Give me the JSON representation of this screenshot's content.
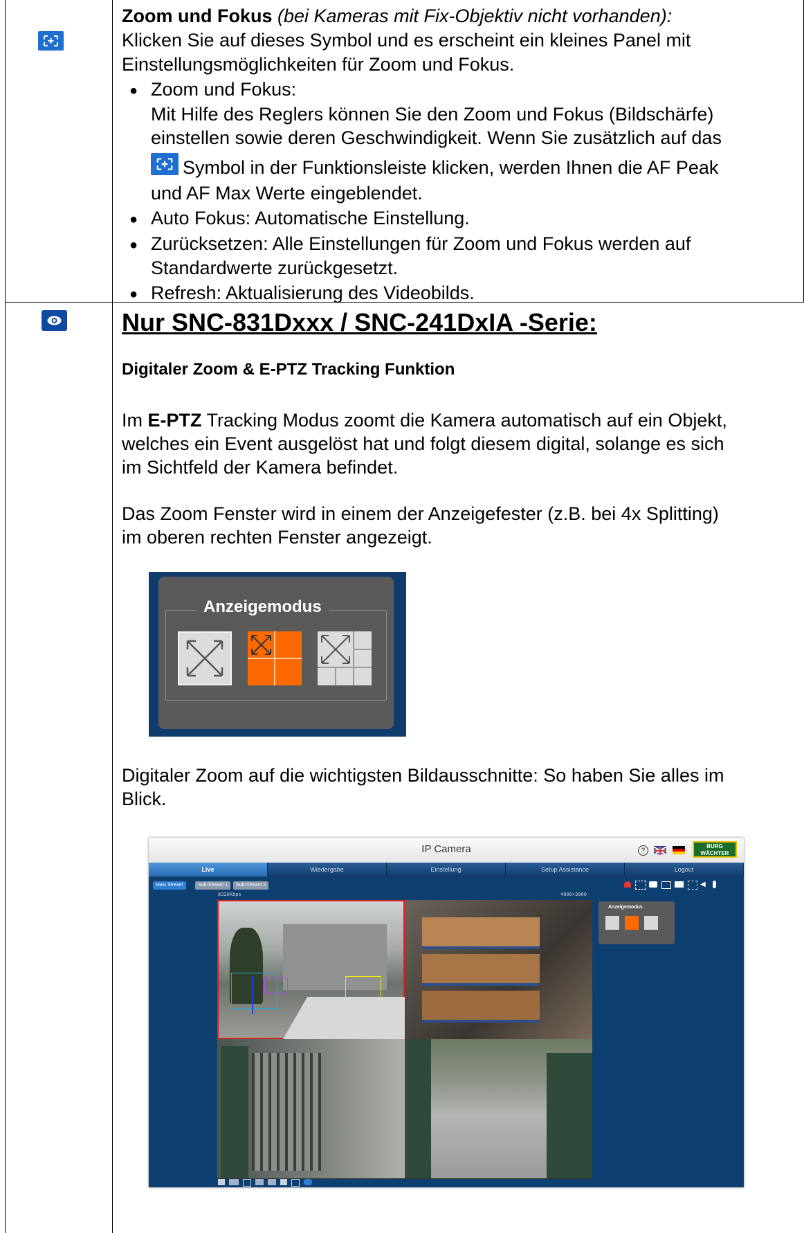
{
  "row1": {
    "icon": "zoom-focus-icon",
    "heading": "Zoom und Fokus",
    "heading_note": "(bei Kameras mit Fix-Objektiv nicht vorhanden):",
    "intro_line1": "Klicken Sie auf dieses Symbol und es erscheint ein kleines Panel mit",
    "intro_line2": "Einstellungsmöglichkeiten für Zoom und Fokus.",
    "bullets": [
      {
        "label": "Zoom und Fokus:",
        "lines": [
          "Mit Hilfe des Reglers können Sie den Zoom und Fokus (Bildschärfe)",
          "einstellen sowie deren Geschwindigkeit. Wenn Sie zusätzlich auf das",
          "Symbol in der Funktionsleiste klicken, werden Ihnen die AF Peak",
          "und AF Max Werte eingeblendet."
        ]
      },
      {
        "label": "Auto Fokus: Automatische Einstellung."
      },
      {
        "label": "Zurücksetzen: Alle Einstellungen für Zoom und Fokus werden auf",
        "line2": "Standardwerte zurückgesetzt."
      },
      {
        "label": "Refresh: Aktualisierung des Videobilds."
      }
    ]
  },
  "row2": {
    "icon": "eye-icon",
    "title": "Nur SNC-831Dxxx / SNC-241DxIA -Serie:",
    "subtitle": "Digitaler Zoom & E-PTZ Tracking Funktion",
    "para1_bold": "E-PTZ",
    "para1_pre": "Im ",
    "para1_line1": " Tracking Modus zoomt die Kamera automatisch auf ein Objekt,",
    "para1_line2": "welches ein Event ausgelöst hat und folgt diesem digital, solange es sich",
    "para1_line3": "im Sichtfeld der Kamera befindet.",
    "para2_line1": "Das Zoom Fenster wird in einem der Anzeigefester (z.B. bei 4x Splitting)",
    "para2_line2": "im oberen rechten Fenster angezeigt.",
    "panel_title": "Anzeigemodus",
    "para3_line1": "Digitaler Zoom auf die wichtigsten Bildausschnitte: So haben Sie alles im",
    "para3_line2": "Blick."
  },
  "camera": {
    "title": "IP Camera",
    "logo": "BURG WÄCHTER",
    "nav": [
      "Live",
      "Wiedergabe",
      "Einstellung",
      "Setup Assistance",
      "Logout"
    ],
    "streams": [
      "Main Stream",
      "Sub-Stream 1",
      "Sub-Stream 2"
    ],
    "bitrate": "8326Kbps",
    "resolution": "4000×3000",
    "side_panel_title": "Anzeigemodus"
  }
}
